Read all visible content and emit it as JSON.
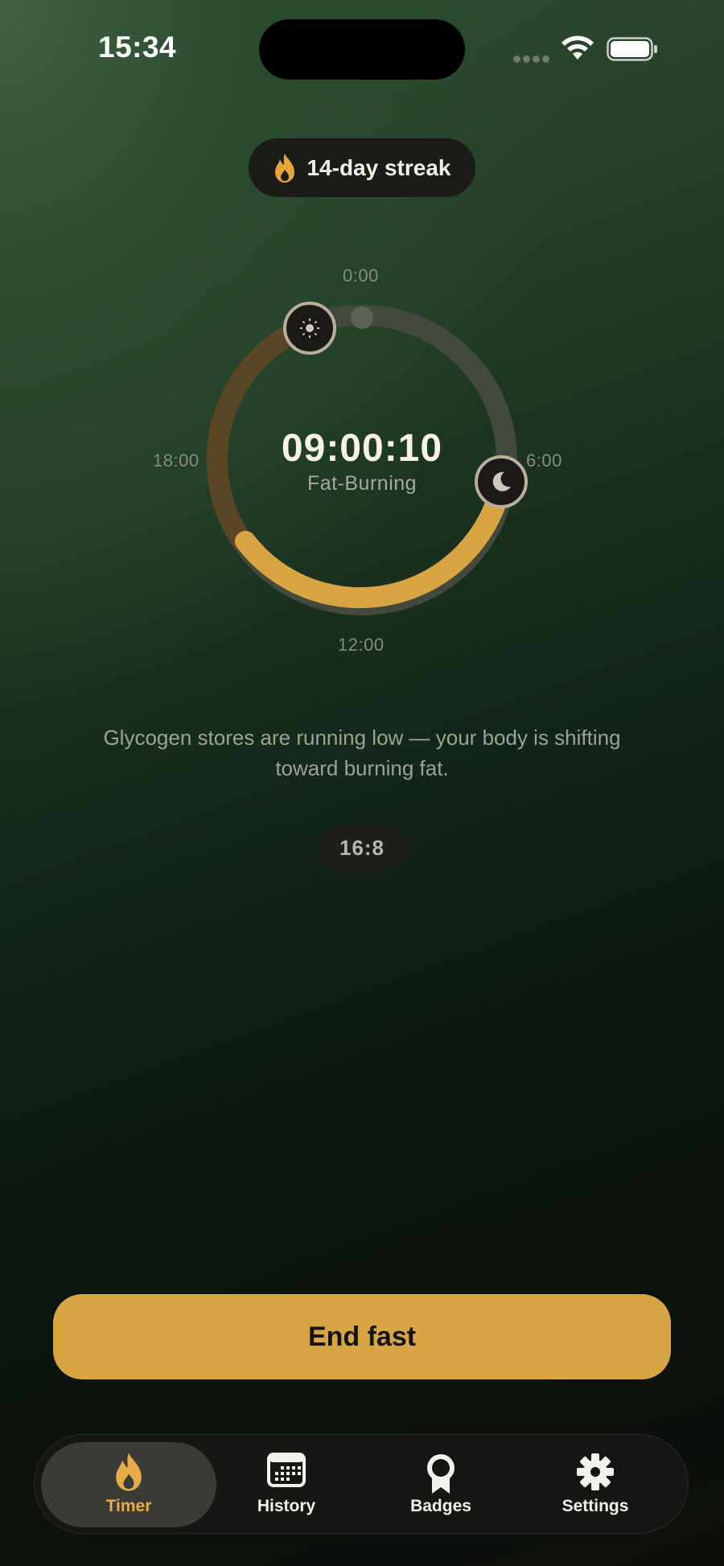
{
  "status_bar": {
    "time": "15:34"
  },
  "streak": {
    "label": "14-day streak",
    "icon": "flame-icon"
  },
  "dial": {
    "tick_top": "0:00",
    "tick_right": "6:00",
    "tick_bottom": "12:00",
    "tick_left": "18:00",
    "timer": "09:00:10",
    "phase": "Fat-Burning",
    "start_marker_icon": "sun-icon",
    "end_marker_icon": "moon-icon",
    "progress_fraction": 0.56,
    "colors": {
      "progress": "#d9a542",
      "eating_window": "#5a4524",
      "fasting_track": "#43493f"
    }
  },
  "description": "Glycogen stores are running low — your body is shifting toward burning fat.",
  "plan": "16:8",
  "actions": {
    "end_fast": "End fast"
  },
  "tabs": [
    {
      "label": "Timer",
      "icon": "flame-icon",
      "active": true
    },
    {
      "label": "History",
      "icon": "calendar-icon",
      "active": false
    },
    {
      "label": "Badges",
      "icon": "award-ribbon-icon",
      "active": false
    },
    {
      "label": "Settings",
      "icon": "gear-icon",
      "active": false
    }
  ],
  "colors": {
    "accent": "#d9a542",
    "text_primary": "#f3efe4",
    "text_muted": "#9ea196"
  }
}
